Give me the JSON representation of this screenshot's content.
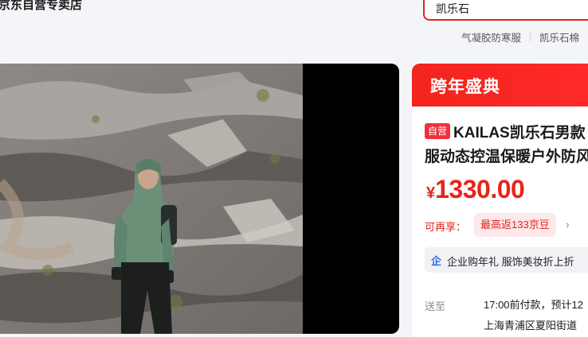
{
  "header": {
    "store_name": "京东自营专卖店",
    "search": {
      "value": "凯乐石"
    },
    "hot_words": [
      "气凝胶防寒服",
      "凯乐石棉"
    ]
  },
  "media": {
    "image_description": "product photo"
  },
  "product": {
    "promo_banner": "跨年盛典",
    "self_tag": "自营",
    "title_line1": "KAILAS凯乐石男款",
    "title_line2": "服动态控温保暖户外防风",
    "price_currency": "¥",
    "price_value": "1330.00",
    "rebate_label": "可再享：",
    "rebate_badge": "最高返133京豆",
    "corp_icon": "企",
    "corp_text": "企业购年礼 服饰美妆折上折",
    "ship_label": "送至",
    "ship_text": "17:00前付款，预计12",
    "address_text": "上海青浦区夏阳街道"
  },
  "colors": {
    "accent": "#e1251b",
    "price": "#e4261b",
    "page_bg": "#f4f5f8"
  }
}
